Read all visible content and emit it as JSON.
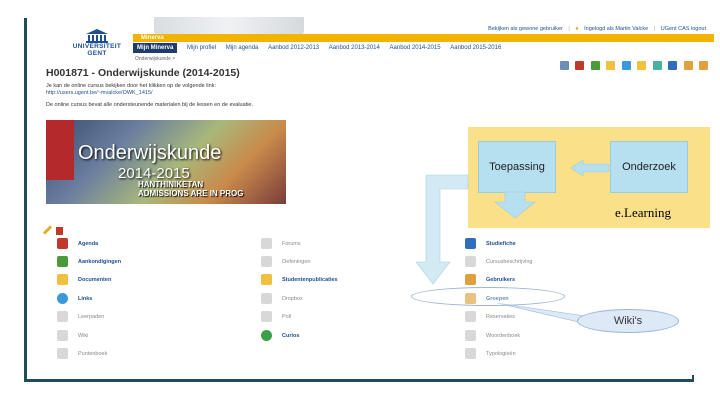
{
  "header": {
    "logo_line1": "UNIVERSITEIT",
    "logo_line2": "GENT",
    "top_links": [
      "Bekijken als gewone gebruiker",
      "Ingelogd als Martin Valcke",
      "UGent CAS logout"
    ],
    "minerva_label": "Minerva",
    "nav": [
      "Mijn Minerva",
      "Mijn profiel",
      "Mijn agenda",
      "Aanbod 2012-2013",
      "Aanbod 2013-2014",
      "Aanbod 2014-2015",
      "Aanbod 2015-2016"
    ],
    "breadcrumb": "Onderwijskunde >"
  },
  "course": {
    "title": "H001871 - Onderwijskunde (2014-2015)",
    "intro": "Je kan de online cursus bekijken door het klikken op de volgende link:",
    "link": "http://users.ugent.be/~mvalcke/OWK_1415/",
    "note": "De online cursus bevat alle ondersteunende materialen bij de lessen en de evaluatie.",
    "image_title": "Onderwijskunde",
    "image_year": "2014-2015",
    "image_bottom": "HANTHINIKETAN",
    "image_bottom2": "ADMISSIONS ARE IN PROG"
  },
  "tools": {
    "col1": [
      "Agenda",
      "Aankondigingen",
      "Documenten",
      "Links",
      "Leerpaden",
      "Wiki",
      "Puntenboek"
    ],
    "col2": [
      "Forums",
      "Oefeningen",
      "Studentenpublicaties",
      "Dropbox",
      "Poll",
      "Curios"
    ],
    "col3": [
      "Studiefiche",
      "Cursusbeschrijving",
      "Gebruikers",
      "Groepen",
      "Reservaties",
      "Woordenboek",
      "Typologieën"
    ]
  },
  "overlay": {
    "box_left": "Toepassing",
    "box_right": "Onderzoek",
    "elearning": "e.Learning",
    "wiki": "Wiki's"
  },
  "colors": {
    "accent_yellow": "#f2b400",
    "nav_dark": "#1f3c6b",
    "link_blue": "#1d4f91",
    "diagram_yellow": "#fbe08a",
    "diagram_box": "#b6dff0"
  }
}
